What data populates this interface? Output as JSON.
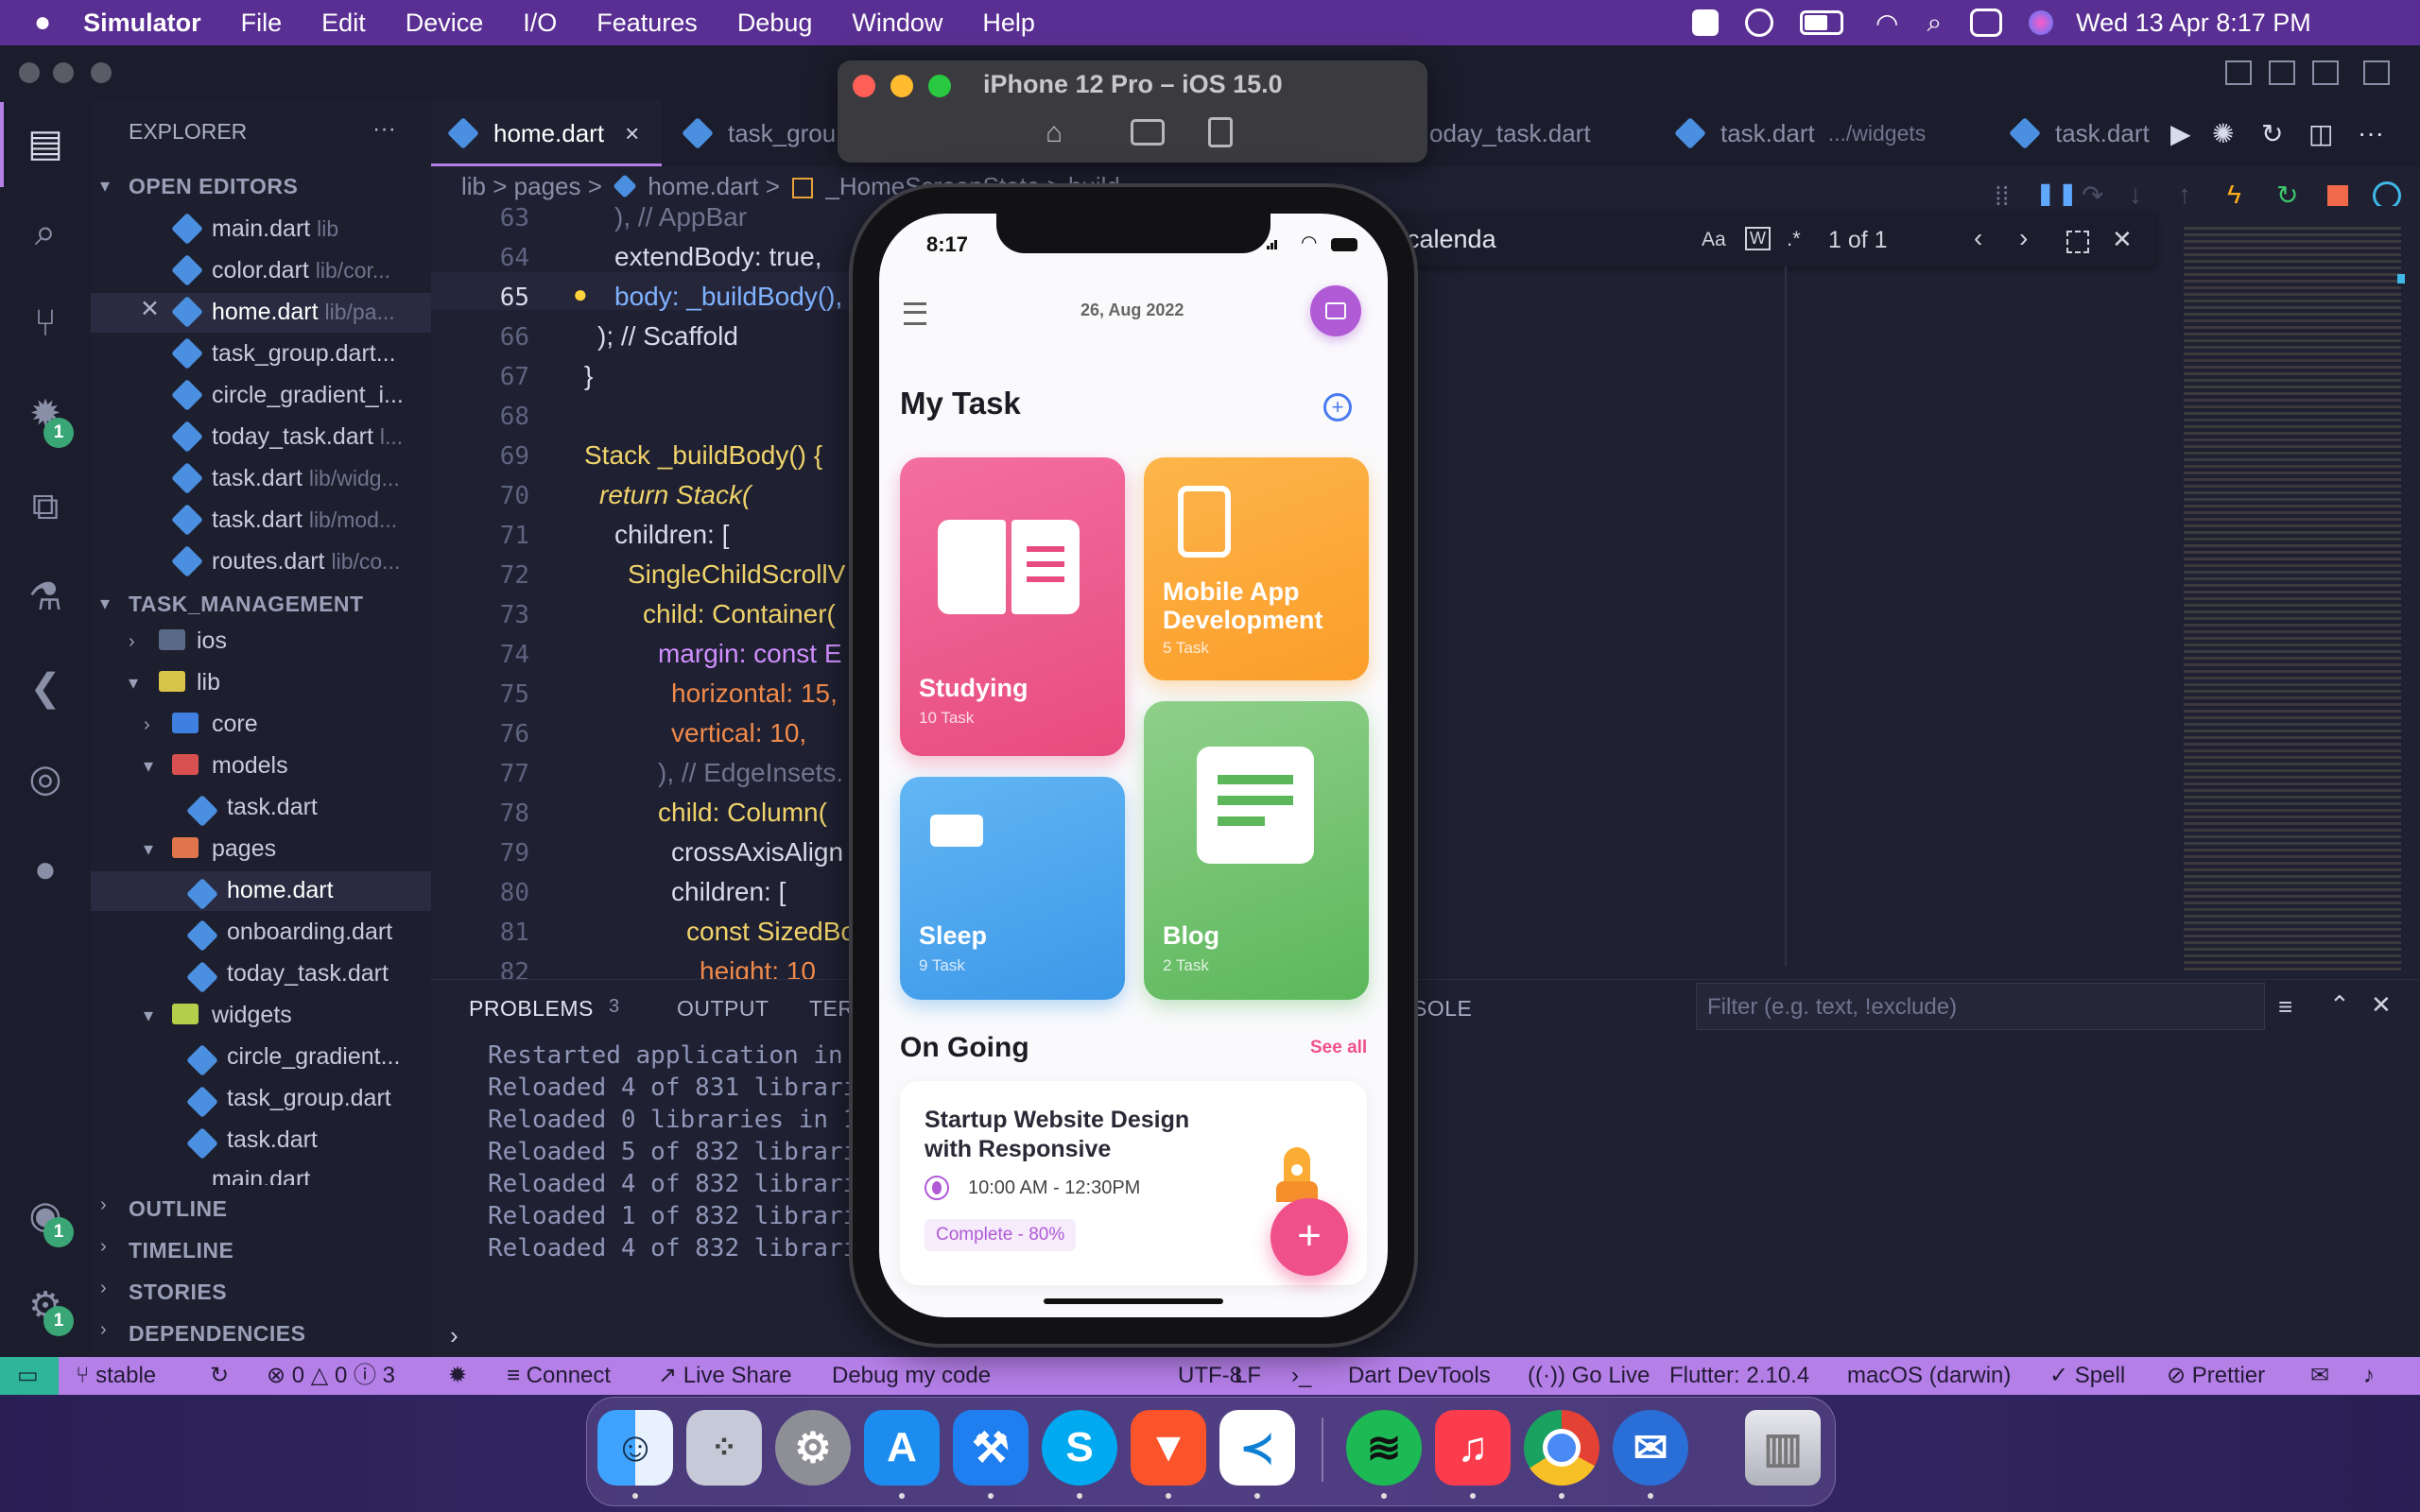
{
  "menubar": {
    "app": "Simulator",
    "items": [
      "File",
      "Edit",
      "Device",
      "I/O",
      "Features",
      "Debug",
      "Window",
      "Help"
    ],
    "clock": "Wed 13 Apr  8:17 PM"
  },
  "activity_badges": {
    "debug": "1",
    "accounts": "1",
    "manage": "1"
  },
  "explorer": {
    "title": "EXPLORER",
    "more": "···",
    "open_editors_header": "OPEN EDITORS",
    "open_editors": [
      {
        "name": "main.dart",
        "path": "lib"
      },
      {
        "name": "color.dart",
        "path": "lib/cor..."
      },
      {
        "name": "home.dart",
        "path": "lib/pa..."
      },
      {
        "name": "task_group.dart...",
        "path": ""
      },
      {
        "name": "circle_gradient_i...",
        "path": ""
      },
      {
        "name": "today_task.dart",
        "path": "l..."
      },
      {
        "name": "task.dart",
        "path": "lib/widg..."
      },
      {
        "name": "task.dart",
        "path": "lib/mod..."
      },
      {
        "name": "routes.dart",
        "path": "lib/co..."
      }
    ],
    "project_header": "TASK_MANAGEMENT",
    "tree": [
      "ios",
      "lib",
      "core",
      "models",
      "task.dart",
      "pages",
      "home.dart",
      "onboarding.dart",
      "today_task.dart",
      "widgets",
      "circle_gradient...",
      "task_group.dart",
      "task.dart",
      "main.dart"
    ],
    "outline": "OUTLINE",
    "timeline": "TIMELINE",
    "stories": "STORIES",
    "dependencies": "DEPENDENCIES"
  },
  "tabs": [
    {
      "label": "home.dart",
      "close": "×"
    },
    {
      "label": "task_grou"
    },
    {
      "label": "oday_task.dart"
    },
    {
      "label": "task.dart",
      "path": ".../widgets"
    },
    {
      "label": "task.dart"
    }
  ],
  "breadcrumb": [
    "lib",
    "pages",
    "home.dart",
    "_HomeScreenState",
    "build"
  ],
  "breadcrumb_sep": ">",
  "find": {
    "query": "calenda",
    "result": "1 of 1",
    "aa": "Aa",
    "w": "W",
    "re": ".*"
  },
  "code_lines": [
    {
      "n": "63",
      "text": "), // AppBar"
    },
    {
      "n": "64",
      "text": "extendBody: true,"
    },
    {
      "n": "65",
      "text": "body: _buildBody(),"
    },
    {
      "n": "66",
      "text": "); // Scaffold"
    },
    {
      "n": "67",
      "text": "}"
    },
    {
      "n": "68",
      "text": ""
    },
    {
      "n": "69",
      "text": "Stack _buildBody() {"
    },
    {
      "n": "70",
      "text": "return Stack("
    },
    {
      "n": "71",
      "text": "children: ["
    },
    {
      "n": "72",
      "text": "SingleChildScrollV"
    },
    {
      "n": "73",
      "text": "child: Container("
    },
    {
      "n": "74",
      "text": "margin: const E"
    },
    {
      "n": "75",
      "text": "horizontal: 15,"
    },
    {
      "n": "76",
      "text": "vertical: 10,"
    },
    {
      "n": "77",
      "text": "), // EdgeInsets."
    },
    {
      "n": "78",
      "text": "child: Column("
    },
    {
      "n": "79",
      "text": "crossAxisAlign"
    },
    {
      "n": "80",
      "text": "children: ["
    },
    {
      "n": "81",
      "text": "const SizedBo"
    },
    {
      "n": "82",
      "text": "height: 10"
    }
  ],
  "panel": {
    "tabs": [
      "PROBLEMS",
      "OUTPUT",
      "TERI",
      "SOLE"
    ],
    "problems_count": "3",
    "filter_placeholder": "Filter (e.g. text, !exclude)",
    "output": [
      "Restarted application in 1,",
      "Reloaded 4 of 831 libraries",
      "Reloaded 0 libraries in 146",
      "Reloaded 5 of 832 libraries",
      "Reloaded 4 of 832 libraries",
      "Reloaded 1 of 832 libraries",
      "Reloaded 4 of 832 libraries"
    ]
  },
  "status": {
    "branch": "stable",
    "errors": "0",
    "warnings": "0",
    "info": "3",
    "connect": "Connect",
    "live_share": "Live Share",
    "debug": "Debug my code",
    "encoding": "UTF-8",
    "eol": "LF",
    "devtools": "Dart DevTools",
    "golive": "Go Live",
    "flutter": "Flutter: 2.10.4",
    "device": "macOS (darwin)",
    "spell": "Spell",
    "prettier": "Prettier"
  },
  "simulator": {
    "title": "iPhone 12 Pro – iOS 15.0"
  },
  "phone": {
    "time": "8:17",
    "date": "26, Aug 2022",
    "my_task": "My Task",
    "cards": [
      {
        "title": "Studying",
        "sub": "10 Task",
        "color": "#ef5f93"
      },
      {
        "title": "Mobile App Development",
        "sub": "5 Task",
        "color": "#fcab3b"
      },
      {
        "title": "Sleep",
        "sub": "9 Task",
        "color": "#52a8ef"
      },
      {
        "title": "Blog",
        "sub": "2 Task",
        "color": "#6dc16b"
      }
    ],
    "ongoing": "On Going",
    "see_all": "See all",
    "ongoing_task": {
      "title": "Startup Website Design with Responsive",
      "time": "10:00 AM - 12:30PM",
      "badge": "Complete - 80%"
    },
    "fab": "+"
  },
  "colors": {
    "accent": "#b57fe8",
    "menubar": "#5a2f93",
    "pink": "#f0508a"
  }
}
